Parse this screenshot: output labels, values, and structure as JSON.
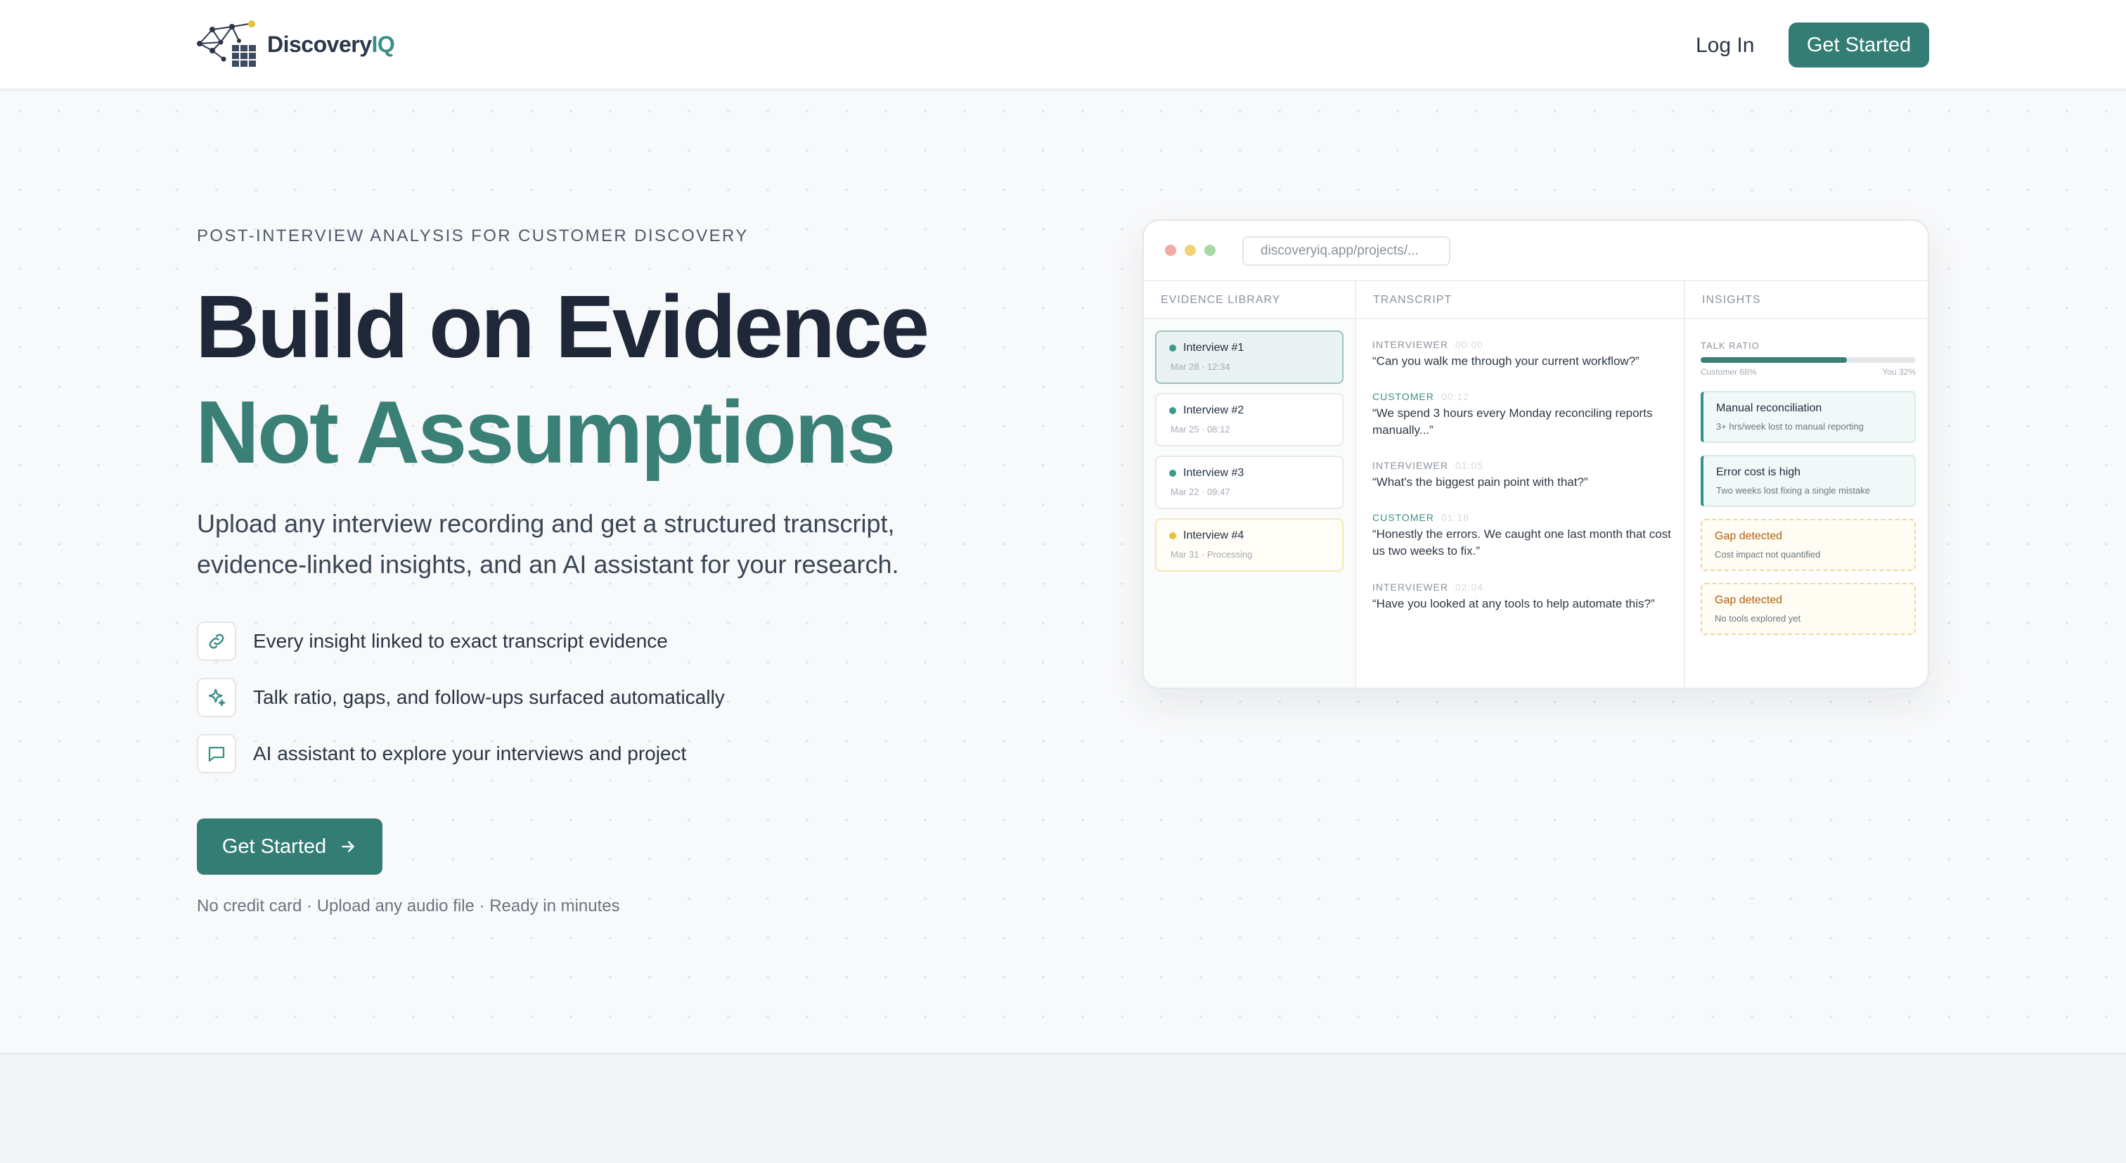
{
  "nav": {
    "brand_prefix": "Discovery",
    "brand_suffix": "IQ",
    "login_label": "Log In",
    "cta_label": "Get Started"
  },
  "hero": {
    "eyebrow": "POST-INTERVIEW ANALYSIS FOR CUSTOMER DISCOVERY",
    "headline_1": "Build on Evidence",
    "headline_2": "Not Assumptions",
    "lead_1": "Upload any interview recording and get a structured transcript,",
    "lead_2": "evidence-linked insights, and an AI assistant for your research.",
    "features": [
      {
        "icon": "link-icon",
        "text": "Every insight linked to exact transcript evidence"
      },
      {
        "icon": "sparkles-icon",
        "text": "Talk ratio, gaps, and follow-ups surfaced automatically"
      },
      {
        "icon": "chat-icon",
        "text": "AI assistant to explore your interviews and project"
      }
    ],
    "cta_label": "Get Started",
    "fine_print": "No credit card · Upload any audio file · Ready in minutes"
  },
  "mockup": {
    "url": "discoveryiq.app/projects/...",
    "columns": {
      "library": "EVIDENCE LIBRARY",
      "transcript": "TRANSCRIPT",
      "insights": "INSIGHTS"
    },
    "interviews": [
      {
        "title": "Interview #1",
        "meta": "Mar 28 · 12:34",
        "status": "active",
        "color": "#3a9b8c"
      },
      {
        "title": "Interview #2",
        "meta": "Mar 25 · 08:12",
        "status": "done",
        "color": "#3a9b8c"
      },
      {
        "title": "Interview #3",
        "meta": "Mar 22 · 09:47",
        "status": "done",
        "color": "#3a9b8c"
      },
      {
        "title": "Interview #4",
        "meta": "Mar 31 · Processing",
        "status": "processing",
        "color": "#e8c23a"
      }
    ],
    "transcript": [
      {
        "speaker": "INTERVIEWER",
        "time": "00:00",
        "text": "“Can you walk me through your current workflow?”"
      },
      {
        "speaker": "CUSTOMER",
        "time": "00:12",
        "text": "“We spend 3 hours every Monday reconciling reports manually...”"
      },
      {
        "speaker": "INTERVIEWER",
        "time": "01:05",
        "text": "“What's the biggest pain point with that?”"
      },
      {
        "speaker": "CUSTOMER",
        "time": "01:18",
        "text": "“Honestly the errors. We caught one last month that cost us two weeks to fix.”"
      },
      {
        "speaker": "INTERVIEWER",
        "time": "02:04",
        "text": "“Have you looked at any tools to help automate this?”"
      }
    ],
    "talk_ratio": {
      "label": "TALK RATIO",
      "customer_label": "Customer 68%",
      "you_label": "You 32%",
      "customer_fraction": 0.68
    },
    "insights": [
      {
        "title": "Manual reconciliation",
        "sub": "3+ hrs/week lost to manual reporting",
        "kind": "green"
      },
      {
        "title": "Error cost is high",
        "sub": "Two weeks lost fixing a single mistake",
        "kind": "green"
      },
      {
        "title": "Gap detected",
        "sub": "Cost impact not quantified",
        "kind": "amber"
      },
      {
        "title": "Gap detected",
        "sub": "No tools explored yet",
        "kind": "amber"
      }
    ]
  },
  "colors": {
    "accent": "#347d75",
    "headline_dark": "#1f2838",
    "headline_green": "#3a8077"
  }
}
